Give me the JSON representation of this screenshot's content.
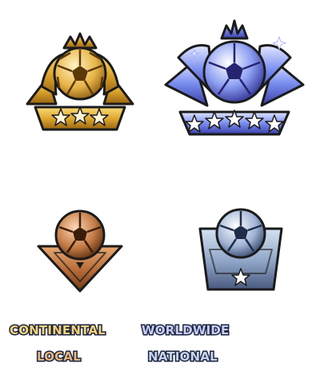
{
  "badges": [
    {
      "id": "continental",
      "label": "CONTINENTAL",
      "tier": "gold",
      "icon": "gold-trophy-icon",
      "stars": 3,
      "colors": {
        "light": "#f7dc7a",
        "mid": "#e0a92f",
        "dark": "#9a6414",
        "label": "#f3d27a"
      }
    },
    {
      "id": "worldwide",
      "label": "WORLDWIDE",
      "tier": "platinum",
      "icon": "platinum-trophy-icon",
      "stars": 5,
      "colors": {
        "light": "#e3e8ff",
        "mid": "#7a8ef0",
        "dark": "#3a3fa8",
        "label": "#c9cdf6"
      }
    },
    {
      "id": "local",
      "label": "LOCAL",
      "tier": "bronze",
      "icon": "bronze-trophy-icon",
      "stars": 0,
      "colors": {
        "light": "#e9a873",
        "mid": "#b56a37",
        "dark": "#6e3a17",
        "label": "#e6b47e"
      }
    },
    {
      "id": "national",
      "label": "NATIONAL",
      "tier": "silver",
      "icon": "silver-trophy-icon",
      "stars": 1,
      "colors": {
        "light": "#d6e2f2",
        "mid": "#8ea4c6",
        "dark": "#48597d",
        "label": "#c9d3ec"
      }
    }
  ]
}
